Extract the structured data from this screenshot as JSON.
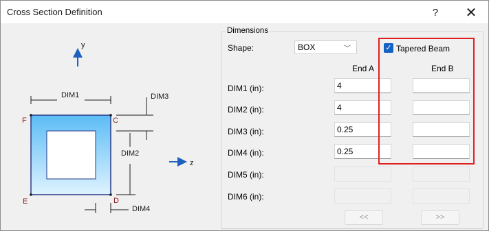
{
  "window": {
    "title": "Cross Section Definition",
    "help_label": "?",
    "close_label": "✕"
  },
  "diagram": {
    "axis_y": "y",
    "axis_z": "z",
    "dim1": "DIM1",
    "dim2": "DIM2",
    "dim3": "DIM3",
    "dim4": "DIM4",
    "corner_c": "C",
    "corner_d": "D",
    "corner_e": "E",
    "corner_f": "F"
  },
  "dimensions": {
    "legend": "Dimensions",
    "shape_label": "Shape:",
    "shape_value": "BOX",
    "tapered_label": "Tapered Beam",
    "tapered_checked": true,
    "end_a_header": "End A",
    "end_b_header": "End B",
    "rows": [
      {
        "label": "DIM1 (in):",
        "end_a": "4",
        "end_b": ""
      },
      {
        "label": "DIM2 (in):",
        "end_a": "4",
        "end_b": ""
      },
      {
        "label": "DIM3 (in):",
        "end_a": "0.25",
        "end_b": ""
      },
      {
        "label": "DIM4 (in):",
        "end_a": "0.25",
        "end_b": ""
      },
      {
        "label": "DIM5 (in):",
        "end_a": "",
        "end_b": ""
      },
      {
        "label": "DIM6 (in):",
        "end_a": "",
        "end_b": ""
      }
    ],
    "prev_button": "<<",
    "next_button": ">>"
  },
  "colors": {
    "highlight": "#e02020",
    "checkbox": "#1463c2",
    "section_fill_top": "#5bbcf5",
    "section_fill_bottom": "#d8f0ff",
    "corner_label": "#8b1a1a"
  }
}
